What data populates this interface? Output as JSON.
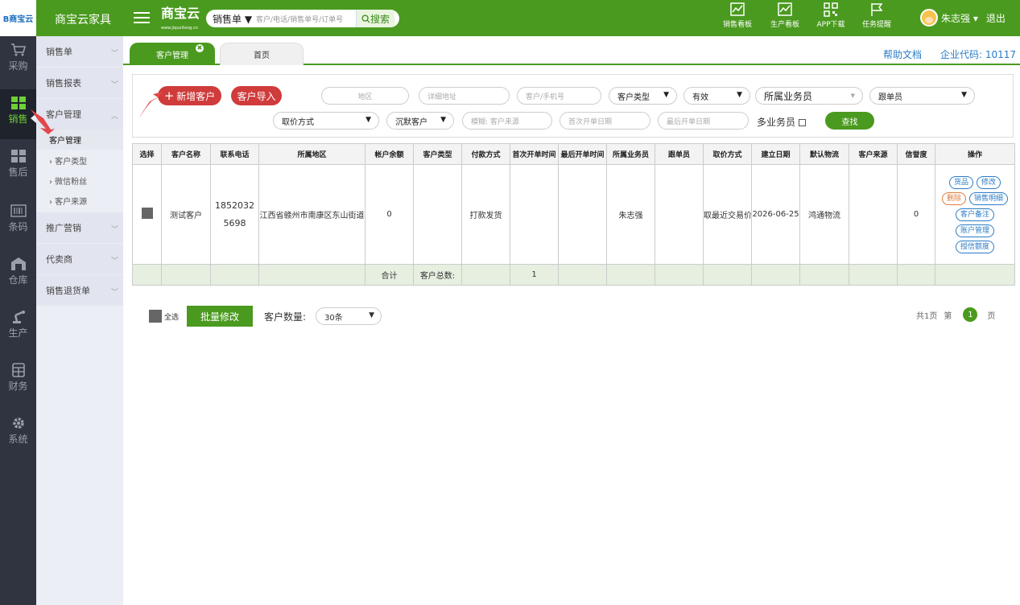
{
  "topbar": {
    "logo": "B商宝云",
    "company": "商宝云家具",
    "brand": "商宝云",
    "brand_sub": "www.jiquxitong.cn",
    "search_select": "销售单 ▼",
    "search_placeholder": "客户/电话/销售单号/订单号",
    "search_button": "搜索",
    "icons": [
      {
        "label": "销售看板",
        "icon": "chart-icon"
      },
      {
        "label": "生产看板",
        "icon": "chart-icon"
      },
      {
        "label": "APP下载",
        "icon": "qrcode-icon"
      },
      {
        "label": "任务提醒",
        "icon": "flag-icon"
      }
    ],
    "user": "朱志强 ▾",
    "logout": "退出"
  },
  "rail": [
    {
      "label": "采购",
      "icon": "cart-icon"
    },
    {
      "label": "销售",
      "icon": "grid-icon"
    },
    {
      "label": "售后",
      "icon": "grid-icon"
    },
    {
      "label": "条码",
      "icon": "barcode-icon"
    },
    {
      "label": "仓库",
      "icon": "warehouse-icon"
    },
    {
      "label": "生产",
      "icon": "robot-arm-icon"
    },
    {
      "label": "财务",
      "icon": "calculator-icon"
    },
    {
      "label": "系统",
      "icon": "gear-icon"
    }
  ],
  "sidebar": {
    "groups": [
      "销售单",
      "销售报表",
      "客户管理",
      "推广营销",
      "代卖商",
      "销售退货单"
    ],
    "subs": [
      "客户管理",
      "› 客户类型",
      "› 微信粉丝",
      "› 客户来源"
    ]
  },
  "tabs": {
    "active": "客户管理",
    "inactive": "首页"
  },
  "help": "帮助文档",
  "enterprise_code": "企业代码: 10117",
  "filter": {
    "add_customer": "新增客户",
    "import_customer": "客户导入",
    "region": "地区",
    "address": "详细地址",
    "customer_phone": "客户/手机号",
    "customer_type": "客户类型",
    "valid": "有效",
    "salesman": "所属业务员",
    "follower": "跟单员",
    "price_method": "取价方式",
    "dormant": "沉默客户",
    "fuzzy_source": "模糊: 客户来源",
    "first_order_date": "首次开单日期",
    "last_order_date": "最后开单日期",
    "multi_salesman": "多业务员",
    "search": "查找"
  },
  "table": {
    "headers": [
      "选择",
      "客户名称",
      "联系电话",
      "所属地区",
      "帐户余额",
      "客户类型",
      "付款方式",
      "首次开单时间",
      "最后开单时间",
      "所属业务员",
      "跟单员",
      "取价方式",
      "建立日期",
      "默认物流",
      "客户来源",
      "信誉度",
      "操作"
    ],
    "row": {
      "name": "测试客户",
      "phone": "18520325698",
      "region": "江西省赣州市南康区东山街道",
      "balance": "0",
      "type": "",
      "payment": "打款发货",
      "first": "",
      "last": "",
      "salesman": "朱志强",
      "follower": "",
      "price": "取最近交易价",
      "created": "2026-06-25",
      "logistics": "鸿通物流",
      "source": "",
      "credit": "0",
      "ops": [
        "货品",
        "修改",
        "删除",
        "销售明细",
        "客户备注",
        "账户管理",
        "授信额度"
      ]
    },
    "summary": {
      "label": "合计",
      "count_label": "客户总数:",
      "count": "1"
    }
  },
  "bottom": {
    "select_all": "全选",
    "batch": "批量修改",
    "qty_label": "客户数量:",
    "qty": "30条"
  },
  "pager": {
    "total": "共1页",
    "prefix": "第",
    "page": "1",
    "suffix": "页"
  }
}
